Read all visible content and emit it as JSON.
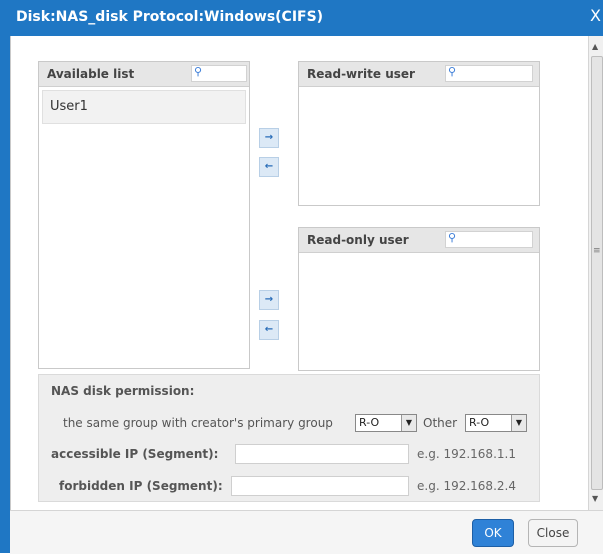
{
  "dialog": {
    "title": "Disk:NAS_disk Protocol:Windows(CIFS)",
    "close_glyph": "X"
  },
  "available": {
    "label": "Available list",
    "search_placeholder": "",
    "users": [
      "User1"
    ]
  },
  "read_write": {
    "label": "Read-write user",
    "search_placeholder": ""
  },
  "read_only": {
    "label": "Read-only user",
    "search_placeholder": ""
  },
  "arrows": {
    "right": "→",
    "left": "←"
  },
  "permission": {
    "heading": "NAS disk permission:",
    "group_label": "the same group with creator's primary group",
    "group_value": "R-O",
    "other_label": "Other",
    "other_value": "R-O",
    "accessible_label": "accessible IP (Segment):",
    "accessible_value": "",
    "accessible_hint": "e.g. 192.168.1.1",
    "forbidden_label": "forbidden IP (Segment):",
    "forbidden_value": "",
    "forbidden_hint": "e.g. 192.168.2.4"
  },
  "buttons": {
    "ok": "OK",
    "close": "Close"
  },
  "icons": {
    "search": "search-icon",
    "dropdown": "triangle-down-icon"
  },
  "colors": {
    "titlebar": "#1f77c4",
    "ok_button": "#2f82d7"
  }
}
